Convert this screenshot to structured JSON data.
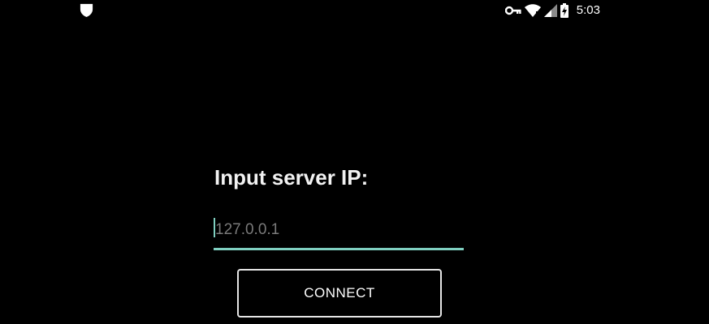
{
  "status_bar": {
    "left_icon": "shield-icon",
    "right_icons": [
      "vpn-key-icon",
      "wifi-icon",
      "cell-signal-icon",
      "battery-charging-icon"
    ],
    "time": "5:03"
  },
  "form": {
    "prompt": "Input server IP:",
    "ip_input": {
      "value": "",
      "placeholder": "127.0.0.1"
    },
    "connect_label": "CONNECT"
  },
  "colors": {
    "background": "#000000",
    "accent": "#7fcfc0",
    "text": "#ffffff"
  }
}
